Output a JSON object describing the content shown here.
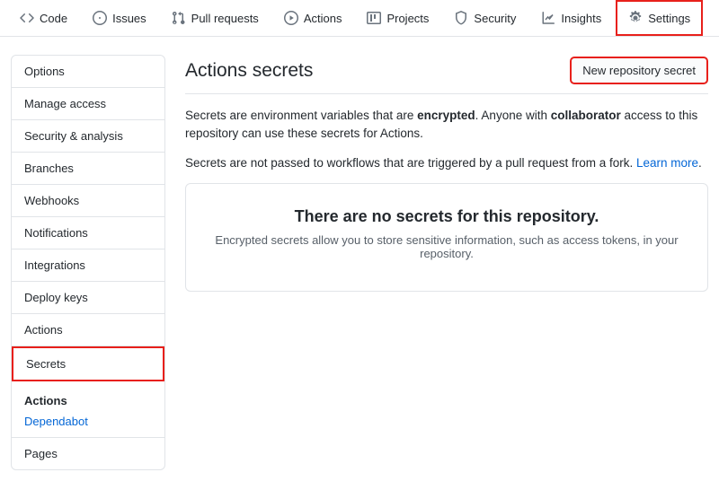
{
  "topnav": {
    "code": "Code",
    "issues": "Issues",
    "pulls": "Pull requests",
    "actions": "Actions",
    "projects": "Projects",
    "security": "Security",
    "insights": "Insights",
    "settings": "Settings"
  },
  "sidebar": {
    "options": "Options",
    "manage_access": "Manage access",
    "security_analysis": "Security & analysis",
    "branches": "Branches",
    "webhooks": "Webhooks",
    "notifications": "Notifications",
    "integrations": "Integrations",
    "deploy_keys": "Deploy keys",
    "actions": "Actions",
    "secrets": "Secrets",
    "sub": {
      "heading": "Actions",
      "dependabot": "Dependabot"
    },
    "pages": "Pages"
  },
  "content": {
    "title": "Actions secrets",
    "new_secret_btn": "New repository secret",
    "desc1_pre": "Secrets are environment variables that are ",
    "desc1_strong1": "encrypted",
    "desc1_mid": ". Anyone with ",
    "desc1_strong2": "collaborator",
    "desc1_post": " access to this repository can use these secrets for Actions.",
    "desc2_pre": "Secrets are not passed to workflows that are triggered by a pull request from a fork. ",
    "desc2_link": "Learn more",
    "desc2_post": ".",
    "empty_heading": "There are no secrets for this repository.",
    "empty_text": "Encrypted secrets allow you to store sensitive information, such as access tokens, in your repository."
  }
}
